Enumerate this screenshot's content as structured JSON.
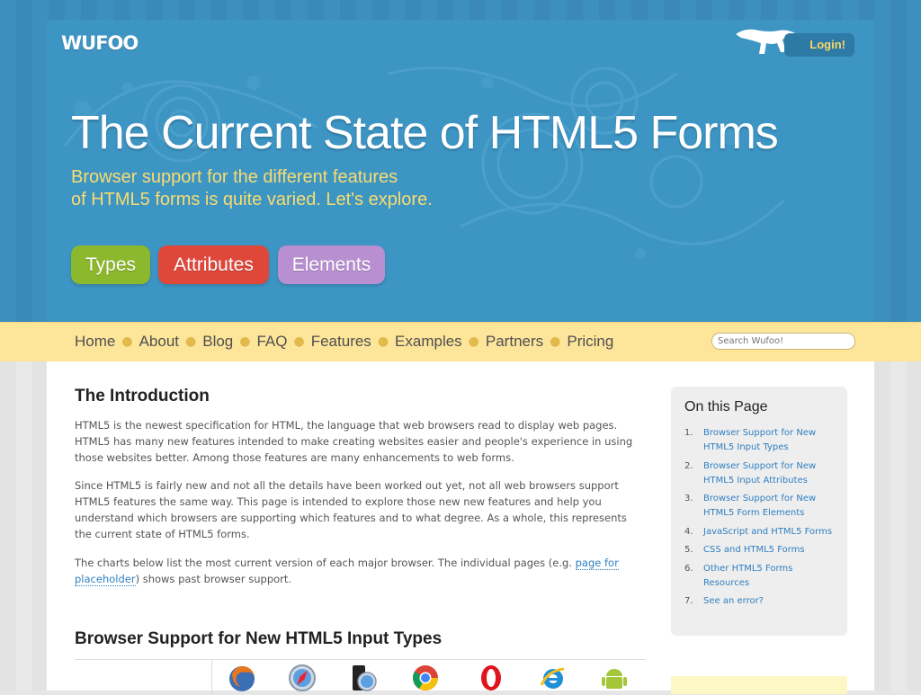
{
  "brand": {
    "logo_text": "WUFOO",
    "login_label": "Login!"
  },
  "hero": {
    "title": "The Current State of HTML5 Forms",
    "subtitle_line1": "Browser support for the different features",
    "subtitle_line2": "of HTML5 forms is quite varied. Let's explore."
  },
  "pills": [
    {
      "label": "Types",
      "color": "#8bb82c"
    },
    {
      "label": "Attributes",
      "color": "#e0473b"
    },
    {
      "label": "Elements",
      "color": "#b88fd0"
    }
  ],
  "nav": {
    "items": [
      "Home",
      "About",
      "Blog",
      "FAQ",
      "Features",
      "Examples",
      "Partners",
      "Pricing"
    ],
    "search_placeholder": "Search Wufoo!"
  },
  "intro": {
    "heading": "The Introduction",
    "p1": "HTML5 is the newest specification for HTML, the language that web browsers read to display web pages. HTML5 has many new features intended to make creating websites easier and people's experience in using those websites better. Among those features are many enhancements to web forms.",
    "p2": "Since HTML5 is fairly new and not all the details have been worked out yet, not all web browsers support HTML5 features the same way. This page is intended to explore those new new features and help you understand which browsers are supporting which features and to what degree. As a whole, this represents the current state of HTML5 forms.",
    "p3_before": "The charts below list the most current version of each major browser. The individual pages (e.g. ",
    "p3_link": "page for placeholder",
    "p3_after": ") shows past browser support."
  },
  "browser_support": {
    "heading": "Browser Support for New HTML5 Input Types",
    "browsers": [
      "firefox-icon",
      "safari-icon",
      "mobile-safari-icon",
      "chrome-icon",
      "opera-icon",
      "internet-explorer-icon",
      "android-icon"
    ]
  },
  "toc": {
    "title": "On this Page",
    "items": [
      {
        "num": "1.",
        "label": "Browser Support for New HTML5 Input Types"
      },
      {
        "num": "2.",
        "label": "Browser Support for New HTML5 Input Attributes"
      },
      {
        "num": "3.",
        "label": "Browser Support for New HTML5 Form Elements"
      },
      {
        "num": "4.",
        "label": "JavaScript and HTML5 Forms"
      },
      {
        "num": "5.",
        "label": "CSS and HTML5 Forms"
      },
      {
        "num": "6.",
        "label": "Other HTML5 Forms Resources"
      },
      {
        "num": "7.",
        "label": "See an error?"
      }
    ]
  },
  "colors": {
    "header_blue": "#3d95c4",
    "subtitle_yellow": "#f9dc6f",
    "nav_yellow": "#fde59a",
    "link_blue": "#2f7fc1"
  }
}
